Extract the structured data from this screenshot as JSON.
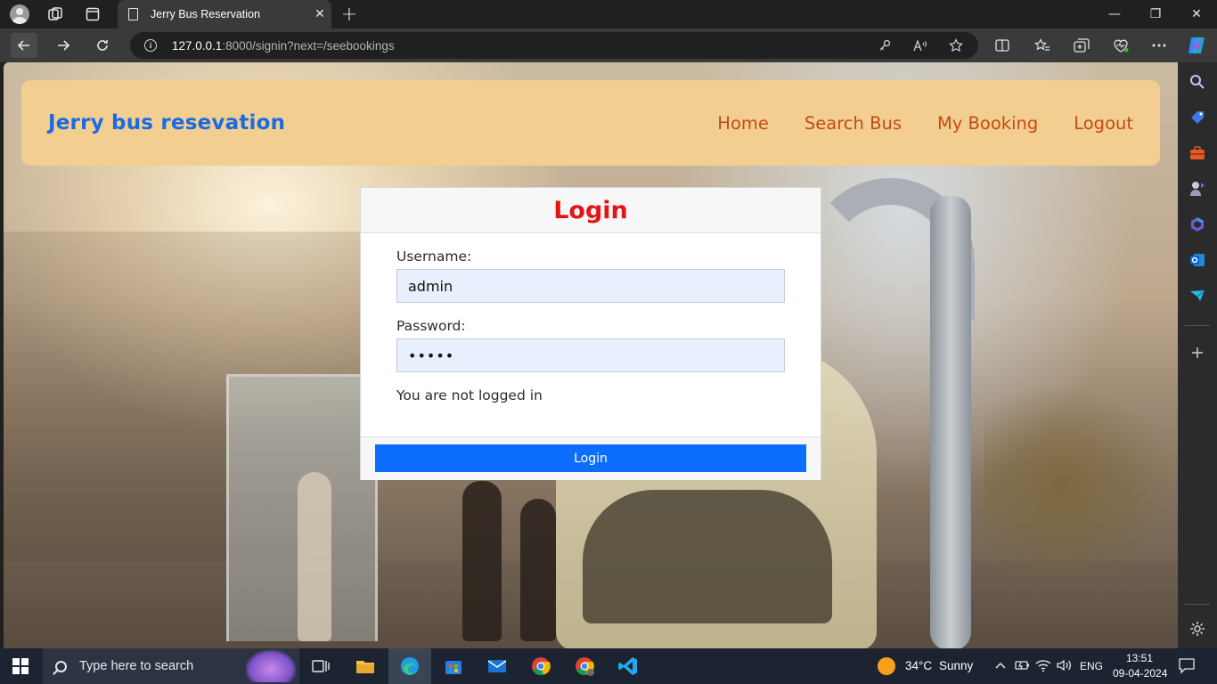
{
  "browser": {
    "tab_title": "Jerry Bus Reservation",
    "url_host": "127.0.0.1",
    "url_path": ":8000/signin?next=/seebookings",
    "newtab_glyph": "+",
    "close_glyph": "✕",
    "minimize_glyph": "—",
    "restore_glyph": "❐",
    "window_close_glyph": "✕"
  },
  "site": {
    "brand": "Jerry bus resevation",
    "nav": [
      "Home",
      "Search Bus",
      "My Booking",
      "Logout"
    ],
    "header_color": "#f2cf91",
    "brand_color": "#1a6be0",
    "nav_color": "#c44a13"
  },
  "login": {
    "title": "Login",
    "username_label": "Username:",
    "username_value": "admin",
    "password_label": "Password:",
    "password_value": "•••••",
    "status": "You are not logged in",
    "submit_label": "Login",
    "title_color": "#e31414",
    "button_color": "#0d6efd"
  },
  "taskbar": {
    "search_placeholder": "Type here to search",
    "weather_temp": "34°C",
    "weather_desc": "Sunny",
    "language": "ENG",
    "time": "13:51",
    "date": "09-04-2024"
  }
}
